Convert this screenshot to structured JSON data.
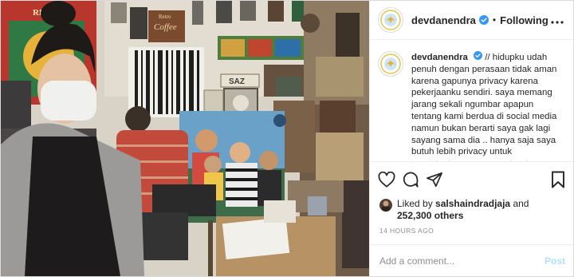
{
  "header": {
    "username": "devdanendra",
    "separator": "•",
    "follow_status": "Following",
    "more_icon": "more-horizontal-icon",
    "verified_icon": "verified-badge-icon"
  },
  "caption": {
    "username": "devdanendra",
    "text": "// hidupku udah penuh dengan perasaan tidak aman karena gapunya privacy karena pekerjaanku sendiri. saya memang jarang sekali ngumbar apapun tentang kami berdua di social media namun bukan berarti saya gak lagi sayang sama dia .. hanya saja saya butuh lebih privacy untuk menjalankan semuanya berdua. terimakasih buat sahabat"
  },
  "actions": {
    "like_icon": "heart-icon",
    "comment_icon": "comment-icon",
    "share_icon": "share-icon",
    "save_icon": "bookmark-icon"
  },
  "likes": {
    "prefix": "Liked by",
    "user": "salshaindradjaja",
    "conjunction": "and",
    "count": "252,300 others"
  },
  "timestamp": "14 HOURS AGO",
  "comment": {
    "placeholder": "Add a comment...",
    "post_label": "Post"
  },
  "photo": {
    "sign_retro": "RETRO",
    "sign_coffee": "Coffee",
    "sign_retro2": "Retro",
    "sign_saz": "SAZ"
  },
  "colors": {
    "verified": "#3897f0",
    "post_disabled": "#b2dffc",
    "muted": "#8e8e8e",
    "text": "#262626",
    "border": "#dbdbdb"
  }
}
